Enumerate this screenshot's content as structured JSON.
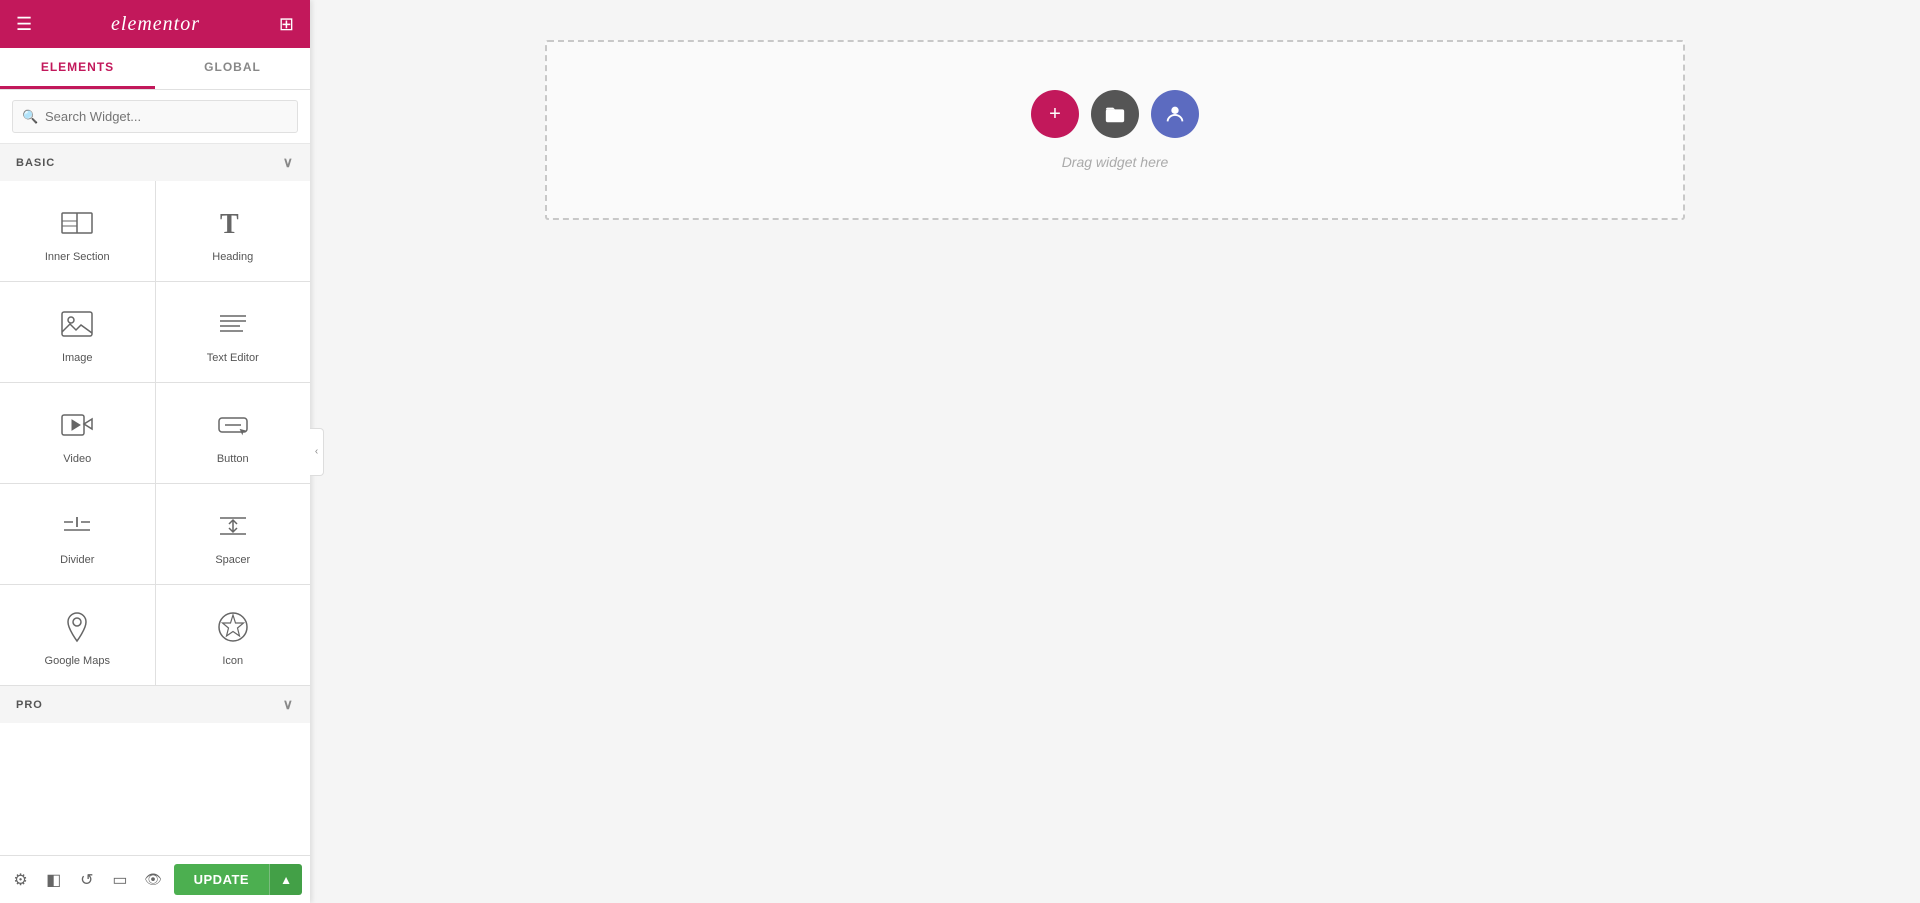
{
  "header": {
    "logo": "elementor",
    "hamburger_label": "☰",
    "grid_label": "⊞"
  },
  "tabs": [
    {
      "id": "elements",
      "label": "ELEMENTS",
      "active": true
    },
    {
      "id": "global",
      "label": "GLOBAL",
      "active": false
    }
  ],
  "search": {
    "placeholder": "Search Widget..."
  },
  "sections": {
    "basic": {
      "label": "BASIC",
      "expanded": true
    },
    "pro": {
      "label": "PRO",
      "expanded": false
    }
  },
  "widgets": [
    {
      "id": "inner-section",
      "label": "Inner Section",
      "icon": "inner-section"
    },
    {
      "id": "heading",
      "label": "Heading",
      "icon": "heading"
    },
    {
      "id": "image",
      "label": "Image",
      "icon": "image"
    },
    {
      "id": "text-editor",
      "label": "Text Editor",
      "icon": "text-editor"
    },
    {
      "id": "video",
      "label": "Video",
      "icon": "video"
    },
    {
      "id": "button",
      "label": "Button",
      "icon": "button"
    },
    {
      "id": "divider",
      "label": "Divider",
      "icon": "divider"
    },
    {
      "id": "spacer",
      "label": "Spacer",
      "icon": "spacer"
    },
    {
      "id": "google-maps",
      "label": "Google Maps",
      "icon": "google-maps"
    },
    {
      "id": "icon",
      "label": "Icon",
      "icon": "icon"
    }
  ],
  "canvas": {
    "drop_text": "Drag widget here"
  },
  "footer": {
    "update_label": "UPDATE",
    "arrow_label": "▲"
  },
  "toolbar_icons": [
    {
      "id": "settings",
      "symbol": "⚙"
    },
    {
      "id": "layers",
      "symbol": "◧"
    },
    {
      "id": "history",
      "symbol": "↺"
    },
    {
      "id": "responsive",
      "symbol": "▭"
    },
    {
      "id": "preview",
      "symbol": "👁"
    }
  ]
}
